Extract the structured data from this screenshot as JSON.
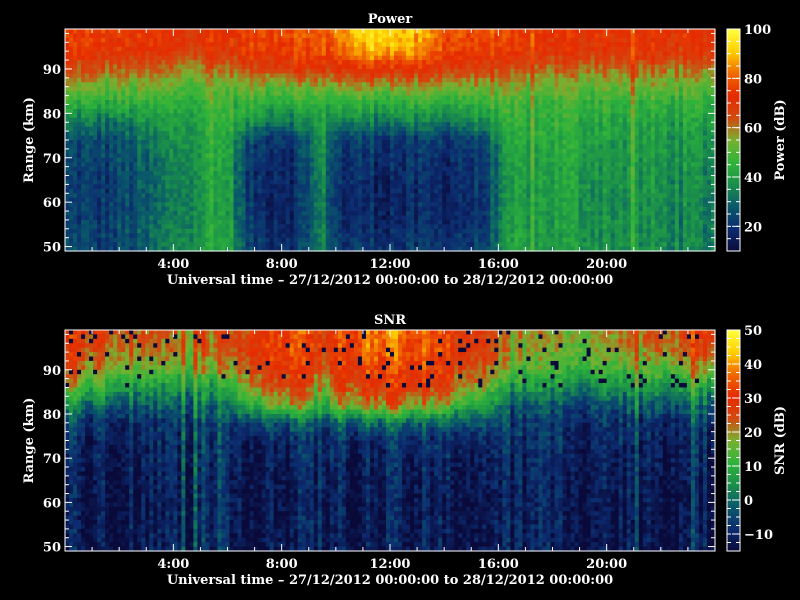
{
  "figure": {
    "background": "#000000",
    "foreground": "#ffffff"
  },
  "chart_data": [
    {
      "type": "heatmap",
      "title": "Power",
      "xlabel": "Universal time – 27/12/2012 00:00:00 to 28/12/2012 00:00:00",
      "ylabel": "Range (km)",
      "x_unit": "hours UT",
      "xlim": [
        0,
        24
      ],
      "ylim": [
        49,
        99
      ],
      "x_ticks": [
        {
          "value": 4,
          "label": "4:00"
        },
        {
          "value": 8,
          "label": "8:00"
        },
        {
          "value": 12,
          "label": "12:00"
        },
        {
          "value": 16,
          "label": "16:00"
        },
        {
          "value": 20,
          "label": "20:00"
        }
      ],
      "y_ticks": [
        {
          "value": 50,
          "label": "50"
        },
        {
          "value": 60,
          "label": "60"
        },
        {
          "value": 70,
          "label": "70"
        },
        {
          "value": 80,
          "label": "80"
        },
        {
          "value": 90,
          "label": "90"
        }
      ],
      "colorbar": {
        "label": "Power (dB)",
        "range": [
          10,
          100
        ],
        "ticks": [
          {
            "value": 20,
            "label": "20"
          },
          {
            "value": 40,
            "label": "40"
          },
          {
            "value": 60,
            "label": "60"
          },
          {
            "value": 80,
            "label": "80"
          },
          {
            "value": 100,
            "label": "100"
          }
        ]
      },
      "colormap": [
        "#0a0a3a",
        "#0c2c70",
        "#0a5a6a",
        "#1a8f4a",
        "#2fb43a",
        "#7ab030",
        "#d24a10",
        "#e62a00",
        "#f06a00",
        "#ffd000",
        "#ffff40"
      ],
      "x_hours": [
        0,
        1.5,
        3,
        4.5,
        6,
        6.8,
        8.5,
        9.5,
        10.2,
        11.5,
        13,
        14,
        15.5,
        16.5,
        18,
        20,
        22,
        24
      ],
      "y_km": [
        50,
        56,
        62,
        68,
        74,
        78,
        82,
        86,
        90,
        94,
        98
      ],
      "values": [
        [
          24,
          22,
          28,
          38,
          42,
          22,
          20,
          35,
          20,
          21,
          20,
          21,
          22,
          40,
          40,
          38,
          36,
          34
        ],
        [
          22,
          22,
          27,
          37,
          41,
          20,
          18,
          34,
          18,
          18,
          17,
          18,
          20,
          39,
          40,
          37,
          36,
          33
        ],
        [
          22,
          21,
          26,
          37,
          41,
          19,
          18,
          34,
          18,
          18,
          17,
          18,
          20,
          38,
          41,
          38,
          37,
          34
        ],
        [
          22,
          22,
          27,
          38,
          42,
          20,
          19,
          35,
          19,
          19,
          18,
          19,
          21,
          39,
          42,
          39,
          38,
          36
        ],
        [
          25,
          24,
          30,
          40,
          44,
          23,
          22,
          37,
          22,
          22,
          21,
          22,
          24,
          41,
          44,
          41,
          39,
          38
        ],
        [
          33,
          31,
          36,
          42,
          46,
          36,
          34,
          40,
          34,
          33,
          33,
          34,
          35,
          44,
          46,
          43,
          41,
          40
        ],
        [
          44,
          43,
          44,
          45,
          47,
          44,
          44,
          44,
          45,
          44,
          44,
          44,
          45,
          46,
          47,
          46,
          45,
          44
        ],
        [
          54,
          52,
          52,
          51,
          52,
          53,
          55,
          54,
          56,
          57,
          56,
          55,
          54,
          53,
          53,
          52,
          52,
          51
        ],
        [
          66,
          63,
          61,
          60,
          61,
          66,
          70,
          68,
          71,
          73,
          71,
          69,
          66,
          63,
          62,
          62,
          61,
          60
        ],
        [
          74,
          72,
          70,
          69,
          70,
          74,
          78,
          77,
          82,
          90,
          84,
          78,
          74,
          72,
          71,
          71,
          70,
          70
        ],
        [
          76,
          74,
          73,
          72,
          72,
          76,
          80,
          79,
          86,
          96,
          88,
          80,
          76,
          74,
          73,
          73,
          72,
          72
        ]
      ]
    },
    {
      "type": "heatmap",
      "title": "SNR",
      "xlabel": "Universal time – 27/12/2012 00:00:00 to 28/12/2012 00:00:00",
      "ylabel": "Range (km)",
      "x_unit": "hours UT",
      "xlim": [
        0,
        24
      ],
      "ylim": [
        49,
        99
      ],
      "x_ticks": [
        {
          "value": 4,
          "label": "4:00"
        },
        {
          "value": 8,
          "label": "8:00"
        },
        {
          "value": 12,
          "label": "12:00"
        },
        {
          "value": 16,
          "label": "16:00"
        },
        {
          "value": 20,
          "label": "20:00"
        }
      ],
      "y_ticks": [
        {
          "value": 50,
          "label": "50"
        },
        {
          "value": 60,
          "label": "60"
        },
        {
          "value": 70,
          "label": "70"
        },
        {
          "value": 80,
          "label": "80"
        },
        {
          "value": 90,
          "label": "90"
        }
      ],
      "colorbar": {
        "label": "SNR (dB)",
        "range": [
          -15,
          50
        ],
        "ticks": [
          {
            "value": -10,
            "label": "−10"
          },
          {
            "value": 0,
            "label": "0"
          },
          {
            "value": 10,
            "label": "10"
          },
          {
            "value": 20,
            "label": "20"
          },
          {
            "value": 30,
            "label": "30"
          },
          {
            "value": 40,
            "label": "40"
          },
          {
            "value": 50,
            "label": "50"
          }
        ]
      },
      "colormap": [
        "#0a0a3a",
        "#0c2c70",
        "#0a5a6a",
        "#1a8f4a",
        "#2fb43a",
        "#7ab030",
        "#d24a10",
        "#e62a00",
        "#f06a00",
        "#ffd000",
        "#ffff40"
      ],
      "x_hours": [
        0,
        1.5,
        3,
        4.5,
        6,
        6.8,
        8.5,
        9.5,
        10.2,
        11.5,
        13,
        14,
        15.5,
        16.5,
        18,
        20,
        22,
        24
      ],
      "y_km": [
        50,
        56,
        62,
        68,
        74,
        78,
        82,
        86,
        90,
        94,
        98
      ],
      "values": [
        [
          -12,
          -12,
          -12,
          -11,
          -12,
          -12,
          -12,
          -11,
          -12,
          -12,
          -12,
          -12,
          -12,
          -11,
          -11,
          -12,
          -12,
          -12
        ],
        [
          -12,
          -12,
          -12,
          -11,
          -12,
          -12,
          -12,
          -11,
          -12,
          -12,
          -12,
          -12,
          -12,
          -11,
          -11,
          -12,
          -12,
          -12
        ],
        [
          -12,
          -11,
          -12,
          -11,
          -11,
          -12,
          -12,
          -10,
          -12,
          -12,
          -12,
          -12,
          -12,
          -11,
          -11,
          -11,
          -12,
          -12
        ],
        [
          -11,
          -11,
          -11,
          -10,
          -11,
          -11,
          -11,
          -9,
          -11,
          -11,
          -11,
          -11,
          -11,
          -10,
          -10,
          -11,
          -11,
          -11
        ],
        [
          -10,
          -10,
          -10,
          -9,
          -10,
          -10,
          -9,
          -8,
          -9,
          -9,
          -9,
          -9,
          -9,
          -9,
          -9,
          -9,
          -10,
          -10
        ],
        [
          -6,
          -7,
          -8,
          -8,
          -8,
          -3,
          -1,
          -5,
          -1,
          0,
          -1,
          -2,
          -3,
          -7,
          -8,
          -8,
          -8,
          -8
        ],
        [
          4,
          0,
          -2,
          -3,
          -2,
          12,
          20,
          8,
          18,
          22,
          20,
          16,
          8,
          -3,
          -4,
          -3,
          -2,
          -1
        ],
        [
          16,
          10,
          6,
          4,
          6,
          22,
          27,
          18,
          26,
          29,
          28,
          25,
          18,
          5,
          4,
          5,
          6,
          8
        ],
        [
          25,
          20,
          16,
          13,
          16,
          27,
          31,
          24,
          30,
          33,
          31,
          29,
          24,
          13,
          12,
          13,
          15,
          18
        ],
        [
          28,
          25,
          22,
          19,
          21,
          30,
          34,
          27,
          33,
          36,
          34,
          31,
          26,
          18,
          16,
          18,
          22,
          26
        ],
        [
          30,
          27,
          24,
          21,
          23,
          30,
          35,
          28,
          34,
          38,
          35,
          32,
          27,
          19,
          17,
          20,
          25,
          29
        ]
      ]
    }
  ]
}
